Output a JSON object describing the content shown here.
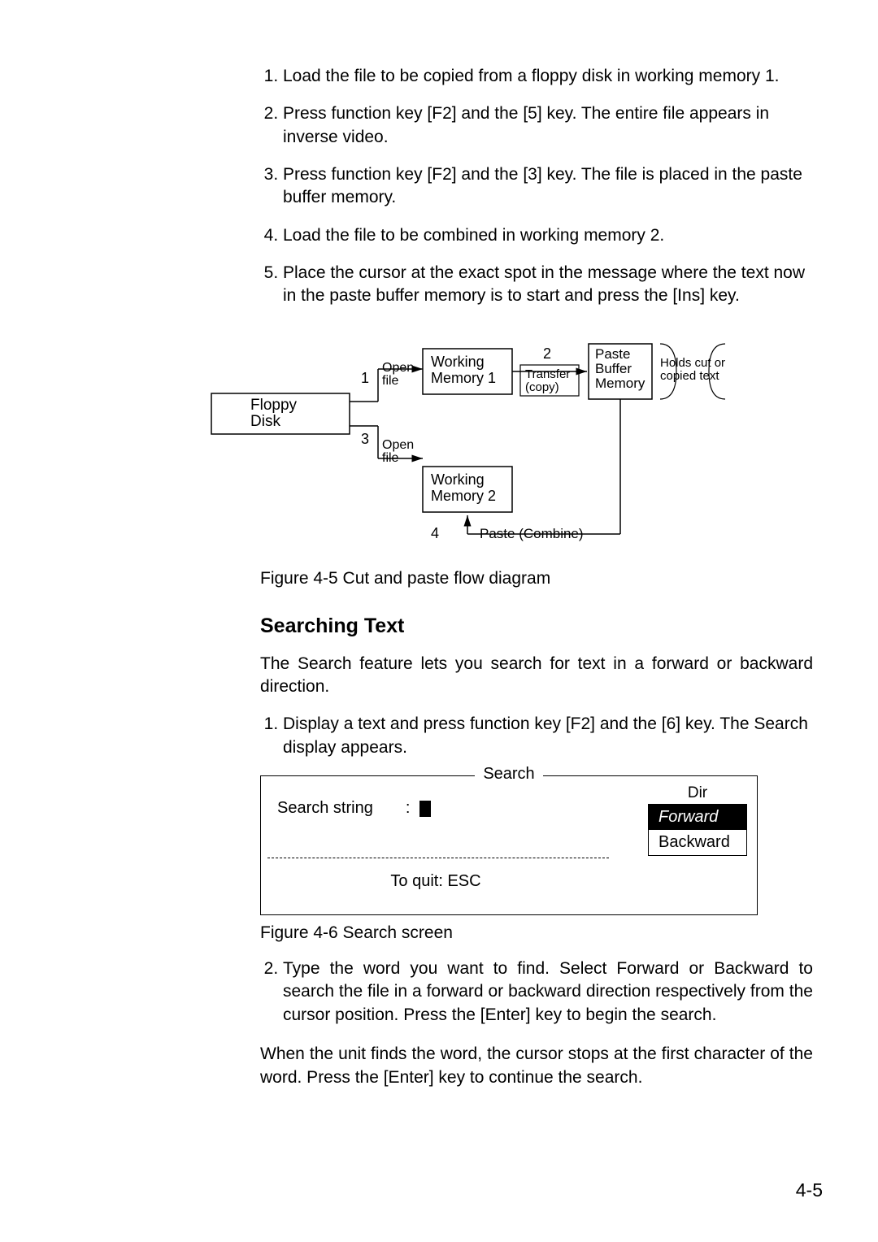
{
  "steps_a": [
    "Load the file to be copied from a floppy disk in working memory 1.",
    "Press function key [F2] and the [5] key. The entire file appears in inverse video.",
    "Press function key [F2] and the [3] key. The file is placed in the paste buffer memory.",
    "Load the file to be combined in working memory 2.",
    "Place the cursor at the exact spot in the message where the text now in the paste buffer memory is to start and press the [Ins] key."
  ],
  "diagram": {
    "floppy": "Floppy\nDisk",
    "open_file": "Open\nfile",
    "working_mem1": "Working\nMemory 1",
    "working_mem2": "Working\nMemory 2",
    "paste_buffer": "Paste\nBuffer\nMemory",
    "holds": "Holds cut or\ncopied text",
    "transfer": "Transfer\n(copy)",
    "paste_combine": "Paste (Combine)",
    "n1": "1",
    "n2": "2",
    "n3": "3",
    "n4": "4"
  },
  "fig45": "Figure 4-5 Cut and paste flow diagram",
  "heading_search": "Searching Text",
  "para_search_intro": "The Search feature lets you search for text in a forward or backward direction.",
  "steps_b1": "Display a text and press function key [F2] and the [6] key. The Search display appears.",
  "search_box": {
    "title": "Search",
    "label": "Search string",
    "colon": ":",
    "quit": "To quit: ESC",
    "dir": "Dir",
    "forward": "Forward",
    "backward": "Backward"
  },
  "fig46": "Figure 4-6 Search screen",
  "steps_b2": "Type the word you want to find. Select Forward or Backward to search the file in a forward or backward direction respectively from the cursor position. Press the [Enter] key to begin the search.",
  "para_result": "When the unit finds the word, the cursor stops at the first character of the word. Press the [Enter] key to continue the search.",
  "page_number": "4-5"
}
